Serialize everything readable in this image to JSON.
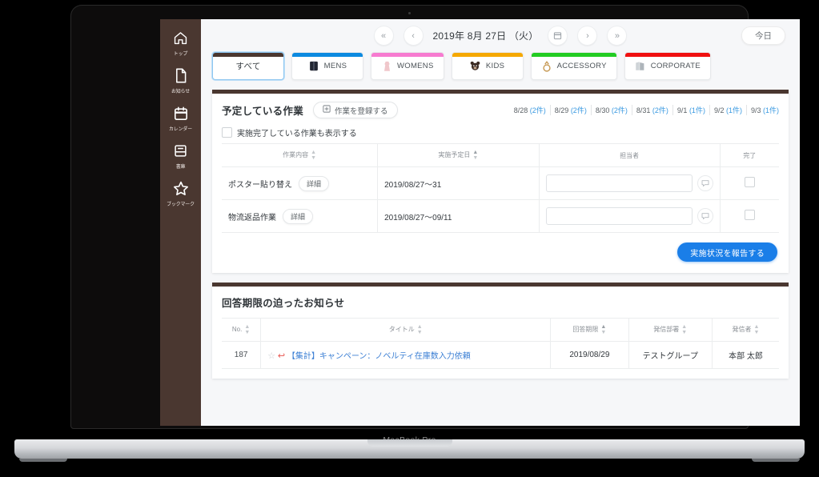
{
  "device": {
    "brand_label": "MacBook Pro"
  },
  "sidebar": {
    "items": [
      {
        "label": "トップ",
        "icon": "home-icon"
      },
      {
        "label": "お知らせ",
        "icon": "document-icon"
      },
      {
        "label": "カレンダー",
        "icon": "calendar-icon"
      },
      {
        "label": "書庫",
        "icon": "book-icon"
      },
      {
        "label": "ブックマーク",
        "icon": "star-icon"
      }
    ]
  },
  "datebar": {
    "first_label": "«",
    "prev_label": "‹",
    "date_text": "2019年 8月 27日 （火）",
    "calendar_icon": "calendar-picker-icon",
    "next_label": "›",
    "last_label": "»",
    "today_label": "今日"
  },
  "tabs": [
    {
      "label": "すべて",
      "color": "#4a3730",
      "selected": true,
      "icon": ""
    },
    {
      "label": "MENS",
      "color": "#0c8ae0",
      "selected": false,
      "icon": "suit-icon"
    },
    {
      "label": "WOMENS",
      "color": "#f77bd0",
      "selected": false,
      "icon": "dress-icon"
    },
    {
      "label": "KIDS",
      "color": "#f5a800",
      "selected": false,
      "icon": "bear-icon"
    },
    {
      "label": "ACCESSORY",
      "color": "#22cc22",
      "selected": false,
      "icon": "ring-icon"
    },
    {
      "label": "CORPORATE",
      "color": "#f01010",
      "selected": false,
      "icon": "building-icon"
    }
  ],
  "tasks": {
    "title": "予定している作業",
    "register_button": "作業を登録する",
    "register_icon": "add-box-icon",
    "day_links": [
      {
        "date": "8/28",
        "count": "(2件)"
      },
      {
        "date": "8/29",
        "count": "(2件)"
      },
      {
        "date": "8/30",
        "count": "(2件)"
      },
      {
        "date": "8/31",
        "count": "(2件)"
      },
      {
        "date": "9/1",
        "count": "(1件)"
      },
      {
        "date": "9/2",
        "count": "(1件)"
      },
      {
        "date": "9/3",
        "count": "(1件)"
      }
    ],
    "show_completed_label": "実施完了している作業も表示する",
    "show_completed_checked": false,
    "columns": [
      "作業内容",
      "実施予定日",
      "担当者",
      "完了"
    ],
    "rows": [
      {
        "name": "ポスター貼り替え",
        "detail_label": "詳細",
        "schedule": "2019/08/27〜31",
        "assignee_value": "",
        "assignee_placeholder": "",
        "comment_icon": "comment-icon",
        "done_checked": false
      },
      {
        "name": "物流返品作業",
        "detail_label": "詳細",
        "schedule": "2019/08/27〜09/11",
        "assignee_value": "",
        "assignee_placeholder": "",
        "comment_icon": "comment-icon",
        "done_checked": false
      }
    ],
    "report_button": "実施状況を報告する"
  },
  "notices": {
    "title": "回答期限の迫ったお知らせ",
    "columns": [
      "No.",
      "タイトル",
      "回答期限",
      "発信部署",
      "発信者"
    ],
    "rows": [
      {
        "no": "187",
        "star_icon": "star-outline-icon",
        "reply_icon": "reply-icon",
        "tag": "【集計】",
        "title": "キャンペーン：ノベルティ在庫数入力依頼",
        "deadline": "2019/08/29",
        "department": "テストグループ",
        "sender": "本部 太郎"
      }
    ]
  },
  "colors": {
    "sidebar": "#4a3730",
    "accent_blue": "#1a7ee8",
    "link_blue": "#3b7fd4",
    "card_top": "#4a3730"
  }
}
